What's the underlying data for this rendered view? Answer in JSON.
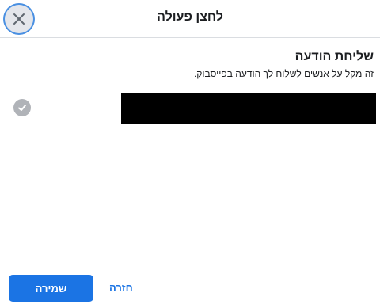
{
  "header": {
    "title": "לחצן פעולה",
    "close_icon": "close-icon"
  },
  "section": {
    "title": "שליחת הודעה",
    "description": "זה מקל על אנשים לשלוח לך הודעה בפייסבוק.",
    "check_icon": "check-circle-icon",
    "field_value_redacted": true
  },
  "footer": {
    "save_label": "שמירה",
    "back_label": "חזרה"
  },
  "colors": {
    "accent": "#1b74e4",
    "close_bg": "#e4e6eb",
    "check_bg": "#b0b3b8",
    "divider": "#dadde1"
  }
}
